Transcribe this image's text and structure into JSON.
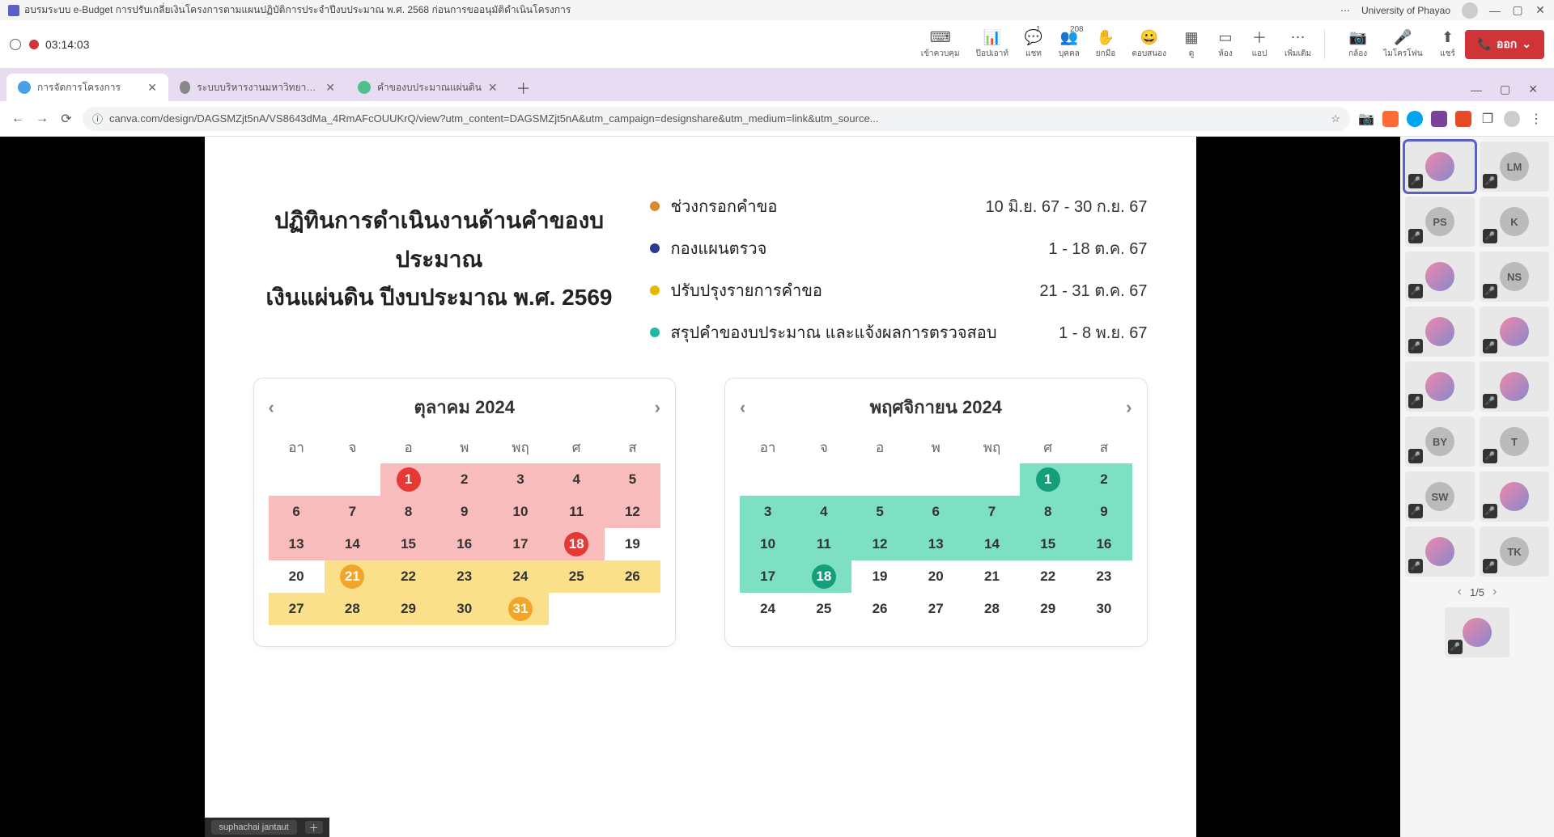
{
  "meeting": {
    "title": "อบรมระบบ e-Budget การปรับเกลี่ยเงินโครงการตามแผนปฏิบัติการประจำปีงบประมาณ พ.ศ. 2568 ก่อนการขออนุมัติดำเนินโครงการ",
    "org": "University of Phayao",
    "rec_time": "03:14:03",
    "people_count": "208",
    "leave_label": "ออก"
  },
  "toolbar": {
    "items": [
      {
        "icon": "⌨",
        "label": "เข้าควบคุม"
      },
      {
        "icon": "📊",
        "label": "ป๊อปเอาท์"
      },
      {
        "icon": "💬",
        "label": "แชท",
        "badge": "1"
      },
      {
        "icon": "👥",
        "label": "บุคคล",
        "badge": "208"
      },
      {
        "icon": "✋",
        "label": "ยกมือ"
      },
      {
        "icon": "😀",
        "label": "ตอบสนอง"
      },
      {
        "icon": "▦",
        "label": "ดู"
      },
      {
        "icon": "▭",
        "label": "ห้อง"
      },
      {
        "icon": "＋",
        "label": "แอป"
      },
      {
        "icon": "⋯",
        "label": "เพิ่มเติม"
      }
    ],
    "camera_label": "กล้อง",
    "mic_label": "ไมโครโฟน",
    "share_label": "แชร์"
  },
  "browser": {
    "tabs": [
      {
        "label": "การจัดการโครงการ",
        "active": true
      },
      {
        "label": "ระบบบริหารงานมหาวิทยาลัยพะเยา",
        "active": false
      },
      {
        "label": "คำของบประมาณแผ่นดิน",
        "active": false
      }
    ],
    "url": "canva.com/design/DAGSMZjt5nA/VS8643dMa_4RmAFcOUUKrQ/view?utm_content=DAGSMZjt5nA&utm_campaign=designshare&utm_medium=link&utm_source..."
  },
  "page": {
    "title_line1": "ปฏิทินการดำเนินงานด้านคำของบประมาณ",
    "title_line2": "เงินแผ่นดิน ปีงบประมาณ พ.ศ. 2569",
    "legend": [
      {
        "color": "#d78b2a",
        "label": "ช่วงกรอกคำขอ",
        "dates": "10 มิ.ย. 67 - 30 ก.ย. 67"
      },
      {
        "color": "#2a3b8f",
        "label": "กองแผนตรวจ",
        "dates": "1 - 18 ต.ค. 67"
      },
      {
        "color": "#e6b800",
        "label": "ปรับปรุงรายการคำขอ",
        "dates": "21 - 31 ต.ค. 67"
      },
      {
        "color": "#20b9a7",
        "label": "สรุปคำของบประมาณ และแจ้งผลการตรวจสอบ",
        "dates": "1 - 8 พ.ย. 67"
      }
    ],
    "dow": [
      "อา",
      "จ",
      "อ",
      "พ",
      "พฤ",
      "ศ",
      "ส"
    ],
    "cal1": {
      "title": "ตุลาคม 2024",
      "weeks": [
        [
          {
            "d": ""
          },
          {
            "d": ""
          },
          {
            "d": "1",
            "circle": "c-red",
            "hl": "hl-pink"
          },
          {
            "d": "2",
            "hl": "hl-pink"
          },
          {
            "d": "3",
            "hl": "hl-pink"
          },
          {
            "d": "4",
            "hl": "hl-pink"
          },
          {
            "d": "5",
            "hl": "hl-pink"
          }
        ],
        [
          {
            "d": "6",
            "hl": "hl-pink"
          },
          {
            "d": "7",
            "hl": "hl-pink"
          },
          {
            "d": "8",
            "hl": "hl-pink"
          },
          {
            "d": "9",
            "hl": "hl-pink"
          },
          {
            "d": "10",
            "hl": "hl-pink"
          },
          {
            "d": "11",
            "hl": "hl-pink"
          },
          {
            "d": "12",
            "hl": "hl-pink"
          }
        ],
        [
          {
            "d": "13",
            "hl": "hl-pink"
          },
          {
            "d": "14",
            "hl": "hl-pink"
          },
          {
            "d": "15",
            "hl": "hl-pink"
          },
          {
            "d": "16",
            "hl": "hl-pink"
          },
          {
            "d": "17",
            "hl": "hl-pink"
          },
          {
            "d": "18",
            "circle": "c-red",
            "hl": "hl-pink"
          },
          {
            "d": "19"
          }
        ],
        [
          {
            "d": "20"
          },
          {
            "d": "21",
            "circle": "c-yellow",
            "hl": "hl-yellow"
          },
          {
            "d": "22",
            "hl": "hl-yellow"
          },
          {
            "d": "23",
            "hl": "hl-yellow"
          },
          {
            "d": "24",
            "hl": "hl-yellow"
          },
          {
            "d": "25",
            "hl": "hl-yellow"
          },
          {
            "d": "26",
            "hl": "hl-yellow"
          }
        ],
        [
          {
            "d": "27",
            "hl": "hl-yellow"
          },
          {
            "d": "28",
            "hl": "hl-yellow"
          },
          {
            "d": "29",
            "hl": "hl-yellow"
          },
          {
            "d": "30",
            "hl": "hl-yellow"
          },
          {
            "d": "31",
            "circle": "c-yellow",
            "hl": "hl-yellow"
          },
          {
            "d": ""
          },
          {
            "d": ""
          }
        ]
      ]
    },
    "cal2": {
      "title": "พฤศจิกายน 2024",
      "weeks": [
        [
          {
            "d": ""
          },
          {
            "d": ""
          },
          {
            "d": ""
          },
          {
            "d": ""
          },
          {
            "d": ""
          },
          {
            "d": "1",
            "circle": "c-teal",
            "hl": "hl-teal"
          },
          {
            "d": "2",
            "hl": "hl-teal"
          }
        ],
        [
          {
            "d": "3",
            "hl": "hl-teal"
          },
          {
            "d": "4",
            "hl": "hl-teal"
          },
          {
            "d": "5",
            "hl": "hl-teal"
          },
          {
            "d": "6",
            "hl": "hl-teal"
          },
          {
            "d": "7",
            "hl": "hl-teal"
          },
          {
            "d": "8",
            "hl": "hl-teal"
          },
          {
            "d": "9",
            "hl": "hl-teal"
          }
        ],
        [
          {
            "d": "10",
            "hl": "hl-teal"
          },
          {
            "d": "11",
            "hl": "hl-teal"
          },
          {
            "d": "12",
            "hl": "hl-teal"
          },
          {
            "d": "13",
            "hl": "hl-teal"
          },
          {
            "d": "14",
            "hl": "hl-teal"
          },
          {
            "d": "15",
            "hl": "hl-teal"
          },
          {
            "d": "16",
            "hl": "hl-teal"
          }
        ],
        [
          {
            "d": "17",
            "hl": "hl-teal"
          },
          {
            "d": "18",
            "circle": "c-teal",
            "hl": "hl-teal"
          },
          {
            "d": "19"
          },
          {
            "d": "20"
          },
          {
            "d": "21"
          },
          {
            "d": "22"
          },
          {
            "d": "23"
          }
        ],
        [
          {
            "d": "24"
          },
          {
            "d": "25"
          },
          {
            "d": "26"
          },
          {
            "d": "27"
          },
          {
            "d": "28"
          },
          {
            "d": "29"
          },
          {
            "d": "30"
          }
        ]
      ]
    }
  },
  "participants": {
    "rows": [
      [
        {
          "type": "img",
          "sel": true
        },
        {
          "initials": "LM"
        }
      ],
      [
        {
          "initials": "PS"
        },
        {
          "initials": "K"
        }
      ],
      [
        {
          "type": "img"
        },
        {
          "initials": "NS"
        }
      ],
      [
        {
          "type": "img"
        },
        {
          "type": "img"
        }
      ],
      [
        {
          "type": "img"
        },
        {
          "type": "img"
        }
      ],
      [
        {
          "initials": "BY"
        },
        {
          "initials": "T"
        }
      ],
      [
        {
          "initials": "SW"
        },
        {
          "type": "img"
        }
      ],
      [
        {
          "type": "img"
        },
        {
          "initials": "TK"
        }
      ]
    ],
    "pager": "1/5",
    "extra": [
      {
        "type": "img"
      }
    ]
  },
  "bottom": {
    "name": "suphachai jantaut"
  }
}
